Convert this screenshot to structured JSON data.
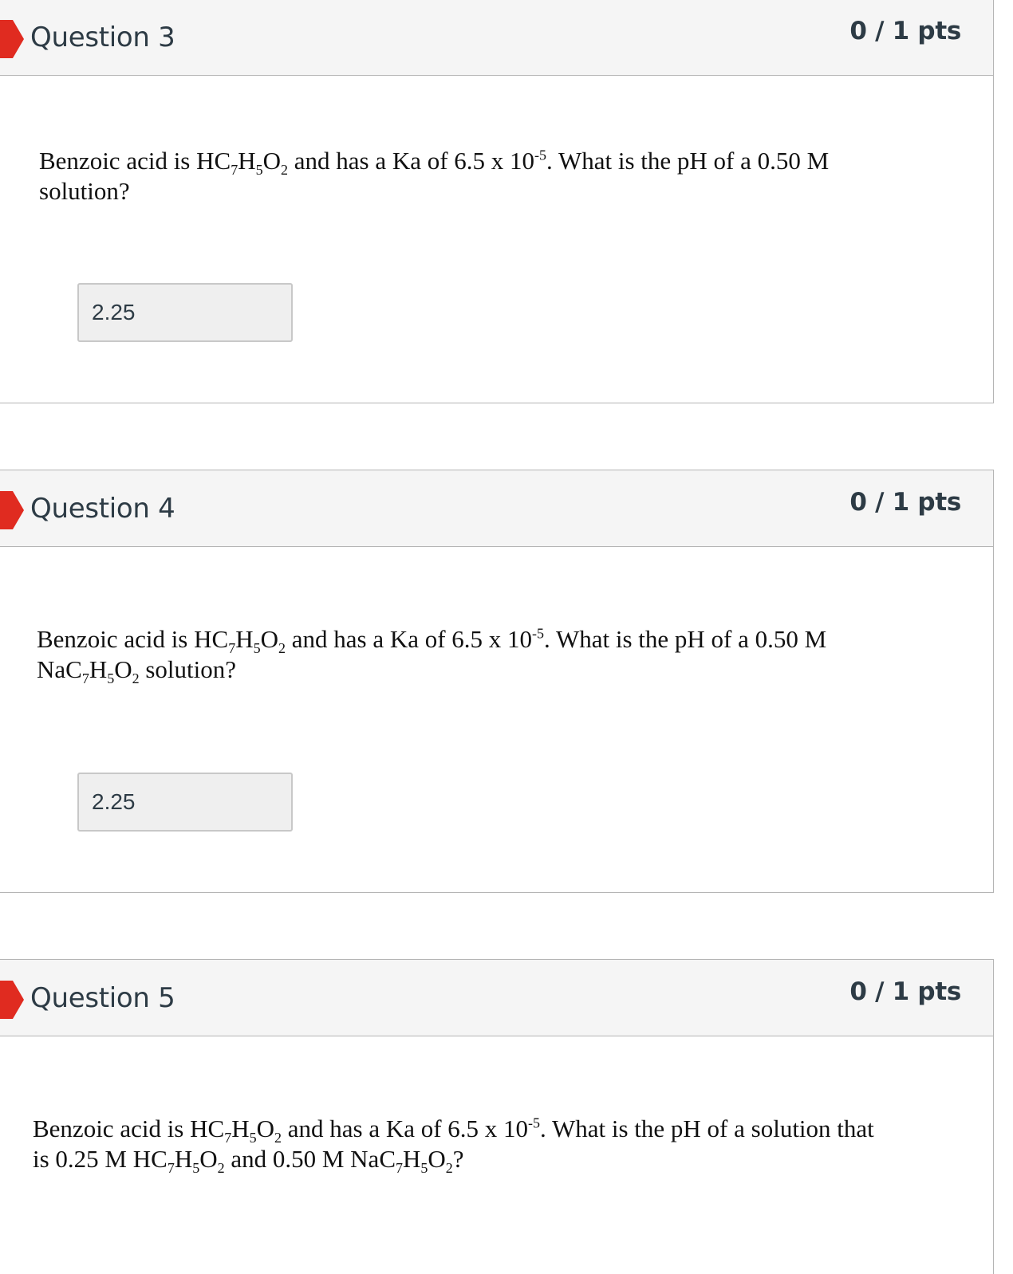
{
  "questions": [
    {
      "title": "Question 3",
      "points": "0 / 1 pts",
      "text_parts": {
        "a": "Benzoic acid is HC",
        "b": "7",
        "c": "H",
        "d": "5",
        "e": "O",
        "f": "2",
        "g": " and has a Ka of 6.5 x 10",
        "h": "-5",
        "i": ".  What is the pH of a 0.50 M",
        "j": "solution?"
      },
      "answer": "2.25"
    },
    {
      "title": "Question 4",
      "points": "0 / 1 pts",
      "text_parts": {
        "a": "Benzoic acid is HC",
        "b": "7",
        "c": "H",
        "d": "5",
        "e": "O",
        "f": "2",
        "g": " and has a Ka of 6.5 x 10",
        "h": "-5",
        "i": ".  What is the pH of a 0.50 M",
        "j": "NaC",
        "k": "7",
        "l": "H",
        "m": "5",
        "n": "O",
        "o": "2",
        "p": " solution?"
      },
      "answer": "2.25"
    },
    {
      "title": "Question 5",
      "points": "0 / 1 pts",
      "text_parts": {
        "a": "Benzoic acid is HC",
        "b": "7",
        "c": "H",
        "d": "5",
        "e": "O",
        "f": "2",
        "g": " and has a Ka of 6.5 x 10",
        "h": "-5",
        "i": ".  What is the pH of a solution that",
        "j": "is 0.25 M HC",
        "k": "7",
        "l": "H",
        "m": "5",
        "n": "O",
        "o": "2",
        "p": " and 0.50 M NaC",
        "q": "7",
        "r": "H",
        "s": "5",
        "t": "O",
        "u": "2",
        "v": "?"
      }
    }
  ],
  "colors": {
    "flag": "#e02b20",
    "header_bg": "#f5f5f5",
    "border": "#b5b5b5",
    "title_text": "#2d3b45"
  },
  "icons": {
    "incorrect_flag": "incorrect-flag-icon"
  }
}
